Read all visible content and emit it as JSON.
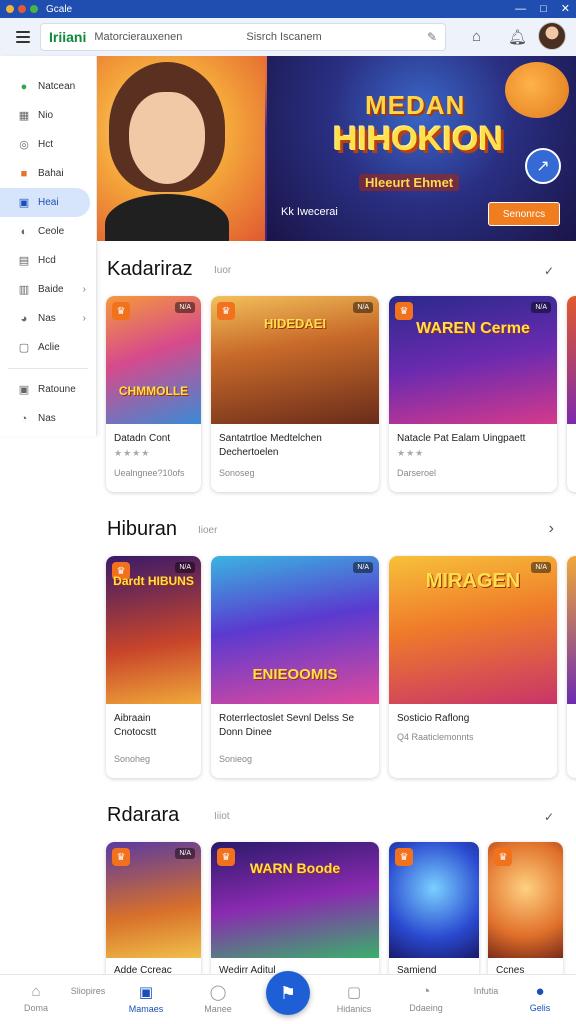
{
  "titlebar": {
    "title": "Gcale",
    "controls": [
      "—",
      "□",
      "✕"
    ]
  },
  "header": {
    "brand": "Iriiani",
    "search_placeholder": "Matorcierauxenen",
    "search_placeholder_right": "Sisrch Iscanem",
    "icons": [
      "home-icon",
      "bell-icon"
    ]
  },
  "sidebar": {
    "items": [
      {
        "label": "Natcean",
        "icon": "●"
      },
      {
        "label": "Nio",
        "icon": "▦"
      },
      {
        "label": "Hct",
        "icon": "◎"
      },
      {
        "label": "Bahai",
        "icon": "■"
      },
      {
        "label": "Heai",
        "icon": "▣"
      },
      {
        "label": "Ceole",
        "icon": "◐"
      },
      {
        "label": "Hcd",
        "icon": "▤"
      },
      {
        "label": "Baide",
        "icon": "▥"
      },
      {
        "label": "Nas",
        "icon": "◕"
      },
      {
        "label": "Aclie",
        "icon": "▢"
      },
      {
        "label": "Ratoune",
        "icon": "▣"
      },
      {
        "label": "Nas",
        "icon": "◔"
      }
    ]
  },
  "hero": {
    "title_line1": "MEDAN",
    "title_line2": "HIHOKION",
    "title_line3": "Hleeurt Ehmet",
    "subtitle": "Kk Iwecerai",
    "button_label": "Senonrcs"
  },
  "sections": [
    {
      "title": "Kadariraz",
      "sub": "Iuor",
      "arrow": "✓",
      "cards": [
        {
          "art": "CHMMOLLE",
          "title": "Datadn Cont",
          "stars": "★★★★",
          "meta": "Uealngnee?10ofs",
          "tag": "N/A"
        },
        {
          "art": "HIDEDAEI",
          "title": "Santatrtloe Medtelchen Dechertoelen",
          "stars": "",
          "meta": "Sonoseg",
          "tag": "N/A"
        },
        {
          "art": "WAREN Cerme",
          "title": "Natacle Pat Ealam Uingpaett",
          "stars": "★★★",
          "meta": "Darseroel",
          "tag": "N/A"
        }
      ]
    },
    {
      "title": "Hiburan",
      "sub": "Iioer",
      "arrow": "›",
      "cards": [
        {
          "art": "Dardt HIBUNS",
          "title": "Aibraain Cnotocstt",
          "stars": "",
          "meta": "Sonoheg",
          "tag": "N/A"
        },
        {
          "art": "ENIEOOMIS",
          "title": "Roterrlectoslet Sevnl Delss Se Donn Dinee",
          "stars": "",
          "meta": "Sonieog",
          "tag": "N/A"
        },
        {
          "art": "MIRAGEN",
          "title": "Sosticio Raflong",
          "stars": "",
          "meta": "Q4 Raaticlemonnts",
          "tag": "N/A"
        }
      ]
    },
    {
      "title": "Rdarara",
      "sub": "Iiiot",
      "arrow": "✓",
      "cards": [
        {
          "art": "",
          "title": "Adde Ccreac",
          "tag": "N/A"
        },
        {
          "art": "WARN Boode",
          "title": "Wedirr Aditul",
          "tag": ""
        },
        {
          "art": "",
          "title": "Samiend",
          "tag": ""
        },
        {
          "art": "",
          "title": "Ccnes",
          "tag": ""
        }
      ]
    }
  ],
  "bottomnav": {
    "items": [
      {
        "label": "Doma",
        "icon": "⌂"
      },
      {
        "label": "Sliopires",
        "icon": ""
      },
      {
        "label": "Mamaes",
        "icon": "▣"
      },
      {
        "label": "Manee",
        "icon": "◯"
      },
      {
        "label": "Hidanics",
        "icon": "▢"
      },
      {
        "label": "Ddaeing",
        "icon": "◔"
      },
      {
        "label": "Infutia",
        "icon": ""
      },
      {
        "label": "Gelis",
        "icon": "●"
      }
    ],
    "fab_icon": "⚑"
  }
}
